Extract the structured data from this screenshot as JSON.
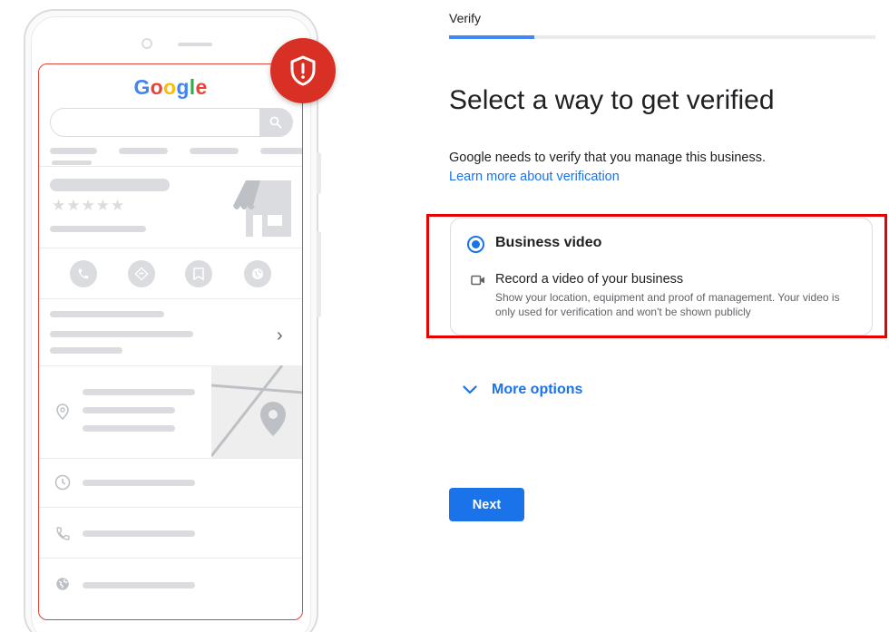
{
  "illustration": {
    "logo_letters": [
      "G",
      "o",
      "o",
      "g",
      "l",
      "e"
    ],
    "logo_colors": [
      "#4285f4",
      "#ea4335",
      "#fbbc05",
      "#4285f4",
      "#34a853",
      "#ea4335"
    ],
    "stars": "★★★★★",
    "chevron": "›",
    "icons": {
      "shield": "shield-alert-icon",
      "search": "search-icon",
      "storefront": "storefront-icon",
      "call": "phone-icon",
      "directions": "directions-icon",
      "save": "bookmark-icon",
      "website": "globe-icon",
      "location": "location-pin-icon",
      "hours": "clock-icon",
      "phone": "phone-icon",
      "web": "globe-icon"
    },
    "accent_colors": {
      "badge": "#d93025",
      "screen_border": "#e0453a"
    }
  },
  "header": {
    "step_label": "Verify",
    "progress": 0.2,
    "progress_color": "#4285f4"
  },
  "main": {
    "title": "Select a way to get verified",
    "description": "Google needs to verify that you manage this business.",
    "learn_more_link": "Learn more about verification",
    "option": {
      "title": "Business video",
      "selected": true,
      "icon": "video-camera-icon",
      "subtitle": "Record a video of your business",
      "detail": "Show your location, equipment and proof of management. Your video is only used for verification and won't be shown publicly"
    },
    "more_options": {
      "label": "More options",
      "icon": "chevron-down-icon"
    },
    "next_button": "Next",
    "colors": {
      "primary": "#1a73e8",
      "highlight": "#e60000"
    }
  }
}
